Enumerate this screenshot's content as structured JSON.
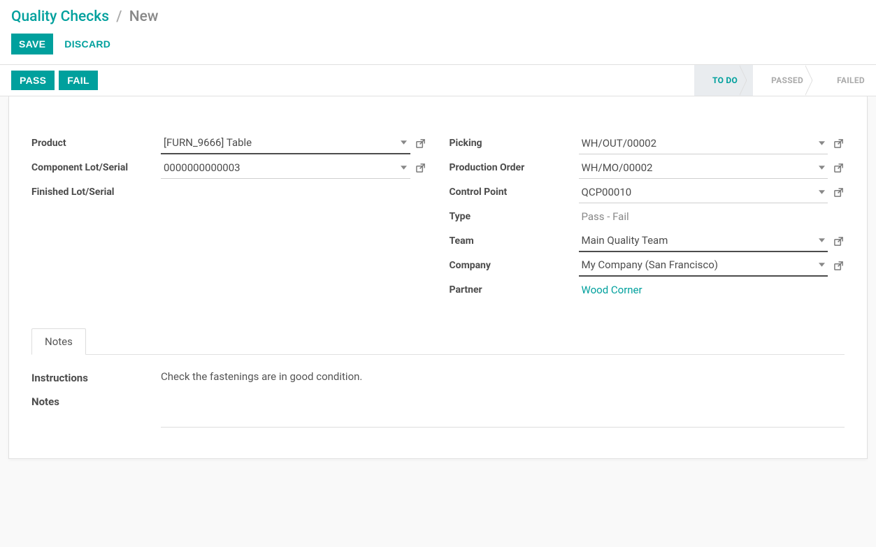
{
  "breadcrumb": {
    "root": "Quality Checks",
    "current": "New"
  },
  "buttons": {
    "save": "SAVE",
    "discard": "DISCARD",
    "pass": "PASS",
    "fail": "FAIL"
  },
  "stages": {
    "todo": "TO DO",
    "passed": "PASSED",
    "failed": "FAILED"
  },
  "form": {
    "left": {
      "product_label": "Product",
      "product_value": "[FURN_9666] Table",
      "component_lot_label": "Component Lot/Serial",
      "component_lot_value": "0000000000003",
      "finished_lot_label": "Finished Lot/Serial",
      "finished_lot_value": ""
    },
    "right": {
      "picking_label": "Picking",
      "picking_value": "WH/OUT/00002",
      "production_order_label": "Production Order",
      "production_order_value": "WH/MO/00002",
      "control_point_label": "Control Point",
      "control_point_value": "QCP00010",
      "type_label": "Type",
      "type_value": "Pass - Fail",
      "team_label": "Team",
      "team_value": "Main Quality Team",
      "company_label": "Company",
      "company_value": "My Company (San Francisco)",
      "partner_label": "Partner",
      "partner_value": "Wood Corner"
    }
  },
  "tabs": {
    "notes": "Notes"
  },
  "notes_pane": {
    "instructions_label": "Instructions",
    "instructions_value": "Check the fastenings are in good condition.",
    "notes_label": "Notes",
    "notes_value": ""
  }
}
